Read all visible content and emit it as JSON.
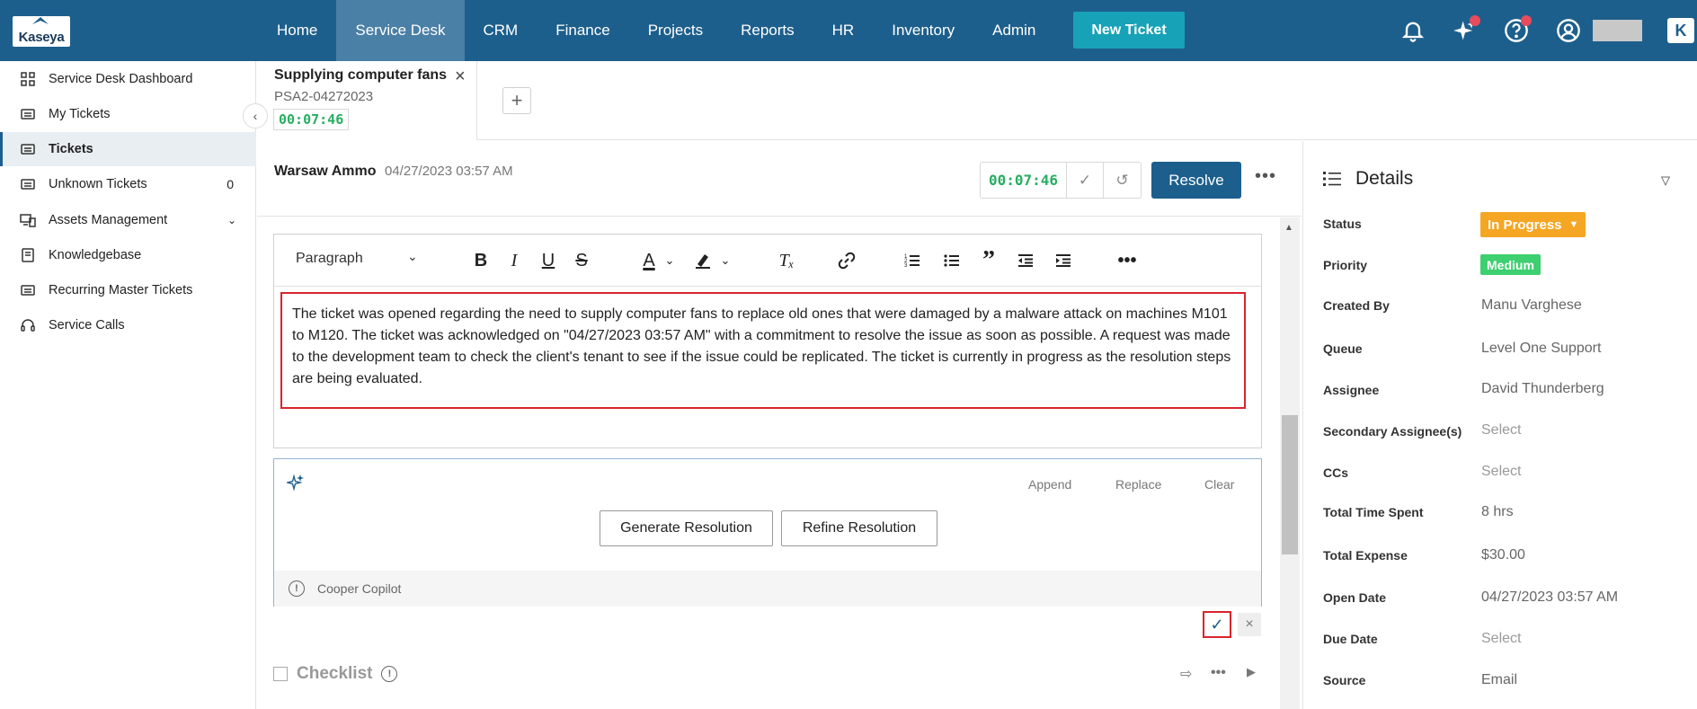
{
  "nav": {
    "logo": "Kaseya",
    "items": [
      {
        "label": "Home"
      },
      {
        "label": "Service Desk"
      },
      {
        "label": "CRM"
      },
      {
        "label": "Finance"
      },
      {
        "label": "Projects"
      },
      {
        "label": "Reports"
      },
      {
        "label": "HR"
      },
      {
        "label": "Inventory"
      },
      {
        "label": "Admin"
      }
    ],
    "active": "Service Desk",
    "new_ticket_label": "New Ticket",
    "icons": [
      "bell-icon",
      "sparkle-icon",
      "help-icon",
      "user-icon"
    ],
    "accent": "#1d5f8c"
  },
  "sidebar": {
    "items": [
      {
        "label": "Service Desk Dashboard",
        "icon": "dashboard-icon"
      },
      {
        "label": "My Tickets",
        "icon": "ticket-icon"
      },
      {
        "label": "Tickets",
        "icon": "ticket-icon"
      },
      {
        "label": "Unknown Tickets",
        "icon": "ticket-icon",
        "count": "0"
      },
      {
        "label": "Assets Management",
        "icon": "devices-icon"
      },
      {
        "label": "Knowledgebase",
        "icon": "book-icon"
      },
      {
        "label": "Recurring Master Tickets",
        "icon": "ticket-icon"
      },
      {
        "label": "Service Calls",
        "icon": "headset-icon"
      }
    ],
    "active": "Tickets"
  },
  "tab": {
    "title": "Supplying computer fans",
    "id": "PSA2-04272023",
    "timer": "00:07:46"
  },
  "ticket": {
    "customer": "Warsaw Ammo",
    "opened": "04/27/2023 03:57 AM",
    "timer": "00:07:46",
    "resolve_label": "Resolve"
  },
  "editor": {
    "block_format": "Paragraph",
    "text": "The ticket was opened regarding the need to supply computer fans to replace old ones that were damaged by a malware attack on machines M101 to M120. The ticket was acknowledged on \"04/27/2023 03:57 AM\" with a commitment to resolve the issue as soon as possible. A request was made to the development team to check the client's tenant to see if the issue could be replicated. The ticket is currently in progress as the resolution steps are being evaluated."
  },
  "copilot": {
    "append_label": "Append",
    "replace_label": "Replace",
    "clear_label": "Clear",
    "generate_label": "Generate Resolution",
    "refine_label": "Refine Resolution",
    "footer": "Cooper Copilot"
  },
  "checklist": {
    "title": "Checklist"
  },
  "details": {
    "title": "Details",
    "status": "In Progress",
    "priority": "Medium",
    "rows": [
      {
        "label": "Status"
      },
      {
        "label": "Priority"
      },
      {
        "label": "Created By",
        "value": "Manu Varghese"
      },
      {
        "label": "Queue",
        "value": "Level One Support"
      },
      {
        "label": "Assignee",
        "value": "David Thunderberg"
      },
      {
        "label": "Secondary Assignee(s)",
        "value": "Select"
      },
      {
        "label": "CCs",
        "value": "Select"
      },
      {
        "label": "Total Time Spent",
        "value": "8 hrs"
      },
      {
        "label": "Total Expense",
        "value": "$30.00"
      },
      {
        "label": "Open Date",
        "value": "04/27/2023 03:57 AM"
      },
      {
        "label": "Due Date",
        "value": "Select"
      },
      {
        "label": "Source",
        "value": "Email"
      }
    ],
    "status_color": "#f5a623",
    "priority_color": "#3ecf70"
  }
}
